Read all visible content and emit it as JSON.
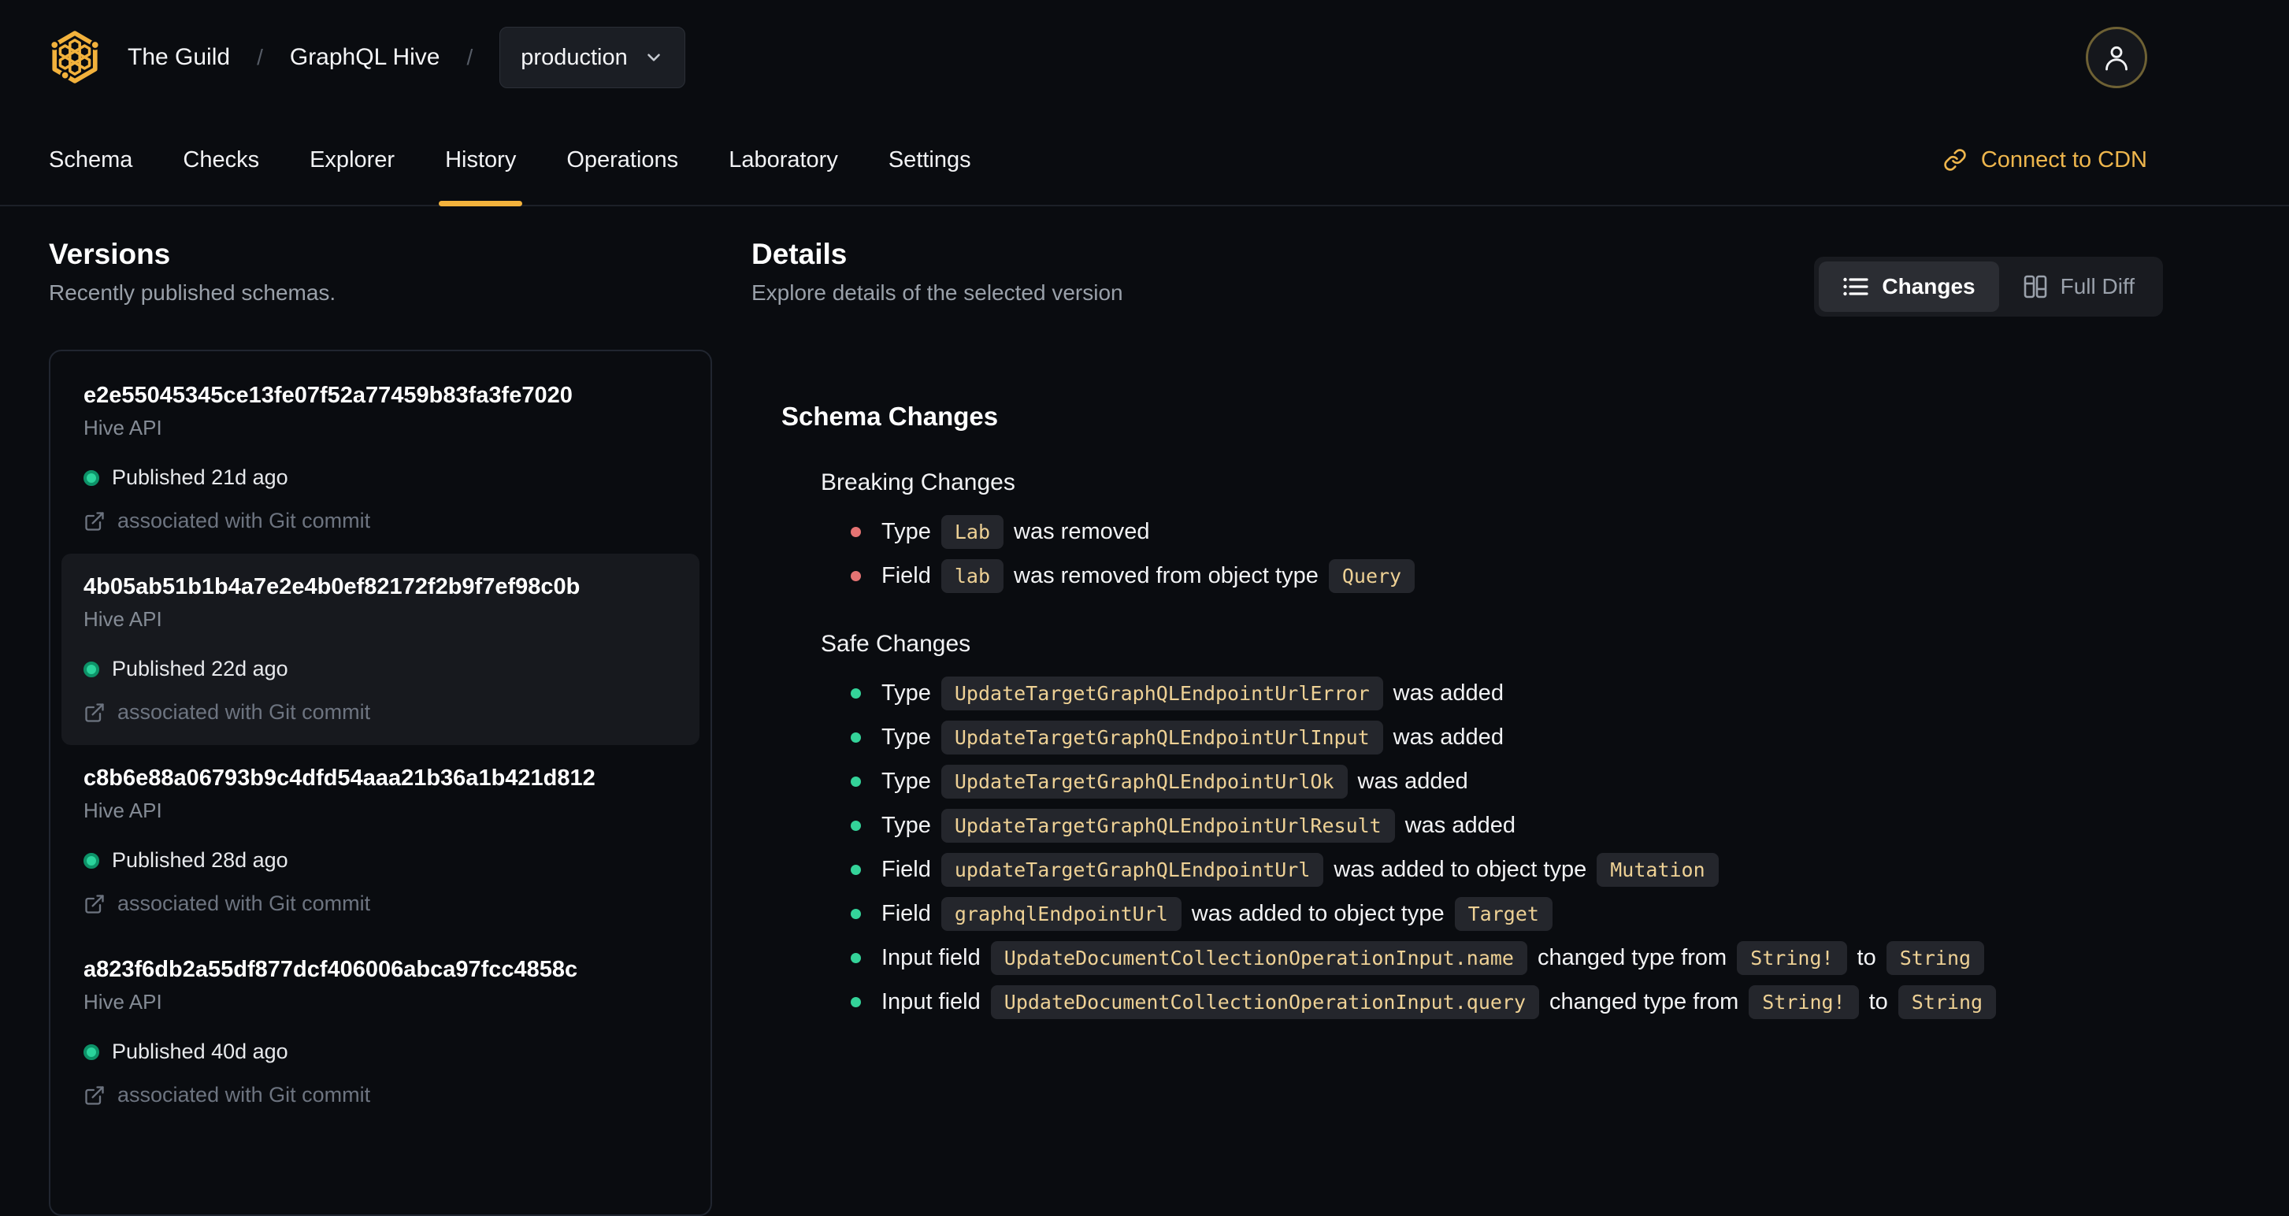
{
  "colors": {
    "background": "#0a0c10",
    "accent_amber": "#f3b23c",
    "cdn_link": "#eeb64d",
    "code_text": "#eed195",
    "breaking_bullet": "#e57373",
    "safe_bullet": "#34d399",
    "published_dot": "#10b981"
  },
  "header": {
    "breadcrumb": {
      "org": "The Guild",
      "separator": "/",
      "project": "GraphQL Hive",
      "target": "production"
    },
    "logo_icon": "hive-logo",
    "target_chevron_icon": "chevron-down-icon",
    "avatar_icon": "user-icon"
  },
  "nav": {
    "tabs": [
      {
        "label": "Schema"
      },
      {
        "label": "Checks"
      },
      {
        "label": "Explorer"
      },
      {
        "label": "History"
      },
      {
        "label": "Operations"
      },
      {
        "label": "Laboratory"
      },
      {
        "label": "Settings"
      }
    ],
    "active_tab": "History",
    "cdn_link": {
      "label": "Connect to CDN",
      "icon": "link-icon"
    }
  },
  "versions_panel": {
    "title": "Versions",
    "subtitle": "Recently published schemas.",
    "items": [
      {
        "hash": "e2e55045345ce13fe07f52a77459b83fa3fe7020",
        "service": "Hive API",
        "published": "Published 21d ago",
        "commit_note": "associated with Git commit",
        "selected": false
      },
      {
        "hash": "4b05ab51b1b4a7e2e4b0ef82172f2b9f7ef98c0b",
        "service": "Hive API",
        "published": "Published 22d ago",
        "commit_note": "associated with Git commit",
        "selected": true
      },
      {
        "hash": "c8b6e88a06793b9c4dfd54aaa21b36a1b421d812",
        "service": "Hive API",
        "published": "Published 28d ago",
        "commit_note": "associated with Git commit",
        "selected": false
      },
      {
        "hash": "a823f6db2a55df877dcf406006abca97fcc4858c",
        "service": "Hive API",
        "published": "Published 40d ago",
        "commit_note": "associated with Git commit",
        "selected": false
      }
    ]
  },
  "details_panel": {
    "title": "Details",
    "subtitle": "Explore details of the selected version",
    "view_toggle": {
      "active": "Changes",
      "options": [
        {
          "label": "Changes",
          "icon": "list-icon"
        },
        {
          "label": "Full Diff",
          "icon": "columns-icon"
        }
      ]
    },
    "schema_changes": {
      "title": "Schema Changes",
      "groups": [
        {
          "name": "Breaking Changes",
          "severity": "breaking",
          "items": [
            [
              {
                "text": "Type"
              },
              {
                "code": "Lab"
              },
              {
                "text": "was removed"
              }
            ],
            [
              {
                "text": "Field"
              },
              {
                "code": "lab"
              },
              {
                "text": "was removed from object type"
              },
              {
                "code": "Query"
              }
            ]
          ]
        },
        {
          "name": "Safe Changes",
          "severity": "safe",
          "items": [
            [
              {
                "text": "Type"
              },
              {
                "code": "UpdateTargetGraphQLEndpointUrlError"
              },
              {
                "text": "was added"
              }
            ],
            [
              {
                "text": "Type"
              },
              {
                "code": "UpdateTargetGraphQLEndpointUrlInput"
              },
              {
                "text": "was added"
              }
            ],
            [
              {
                "text": "Type"
              },
              {
                "code": "UpdateTargetGraphQLEndpointUrlOk"
              },
              {
                "text": "was added"
              }
            ],
            [
              {
                "text": "Type"
              },
              {
                "code": "UpdateTargetGraphQLEndpointUrlResult"
              },
              {
                "text": "was added"
              }
            ],
            [
              {
                "text": "Field"
              },
              {
                "code": "updateTargetGraphQLEndpointUrl"
              },
              {
                "text": "was added to object type"
              },
              {
                "code": "Mutation"
              }
            ],
            [
              {
                "text": "Field"
              },
              {
                "code": "graphqlEndpointUrl"
              },
              {
                "text": "was added to object type"
              },
              {
                "code": "Target"
              }
            ],
            [
              {
                "text": "Input field"
              },
              {
                "code": "UpdateDocumentCollectionOperationInput.name"
              },
              {
                "text": "changed type from"
              },
              {
                "code": "String!"
              },
              {
                "text": "to"
              },
              {
                "code": "String"
              }
            ],
            [
              {
                "text": "Input field"
              },
              {
                "code": "UpdateDocumentCollectionOperationInput.query"
              },
              {
                "text": "changed type from"
              },
              {
                "code": "String!"
              },
              {
                "text": "to"
              },
              {
                "code": "String"
              }
            ]
          ]
        }
      ]
    }
  }
}
